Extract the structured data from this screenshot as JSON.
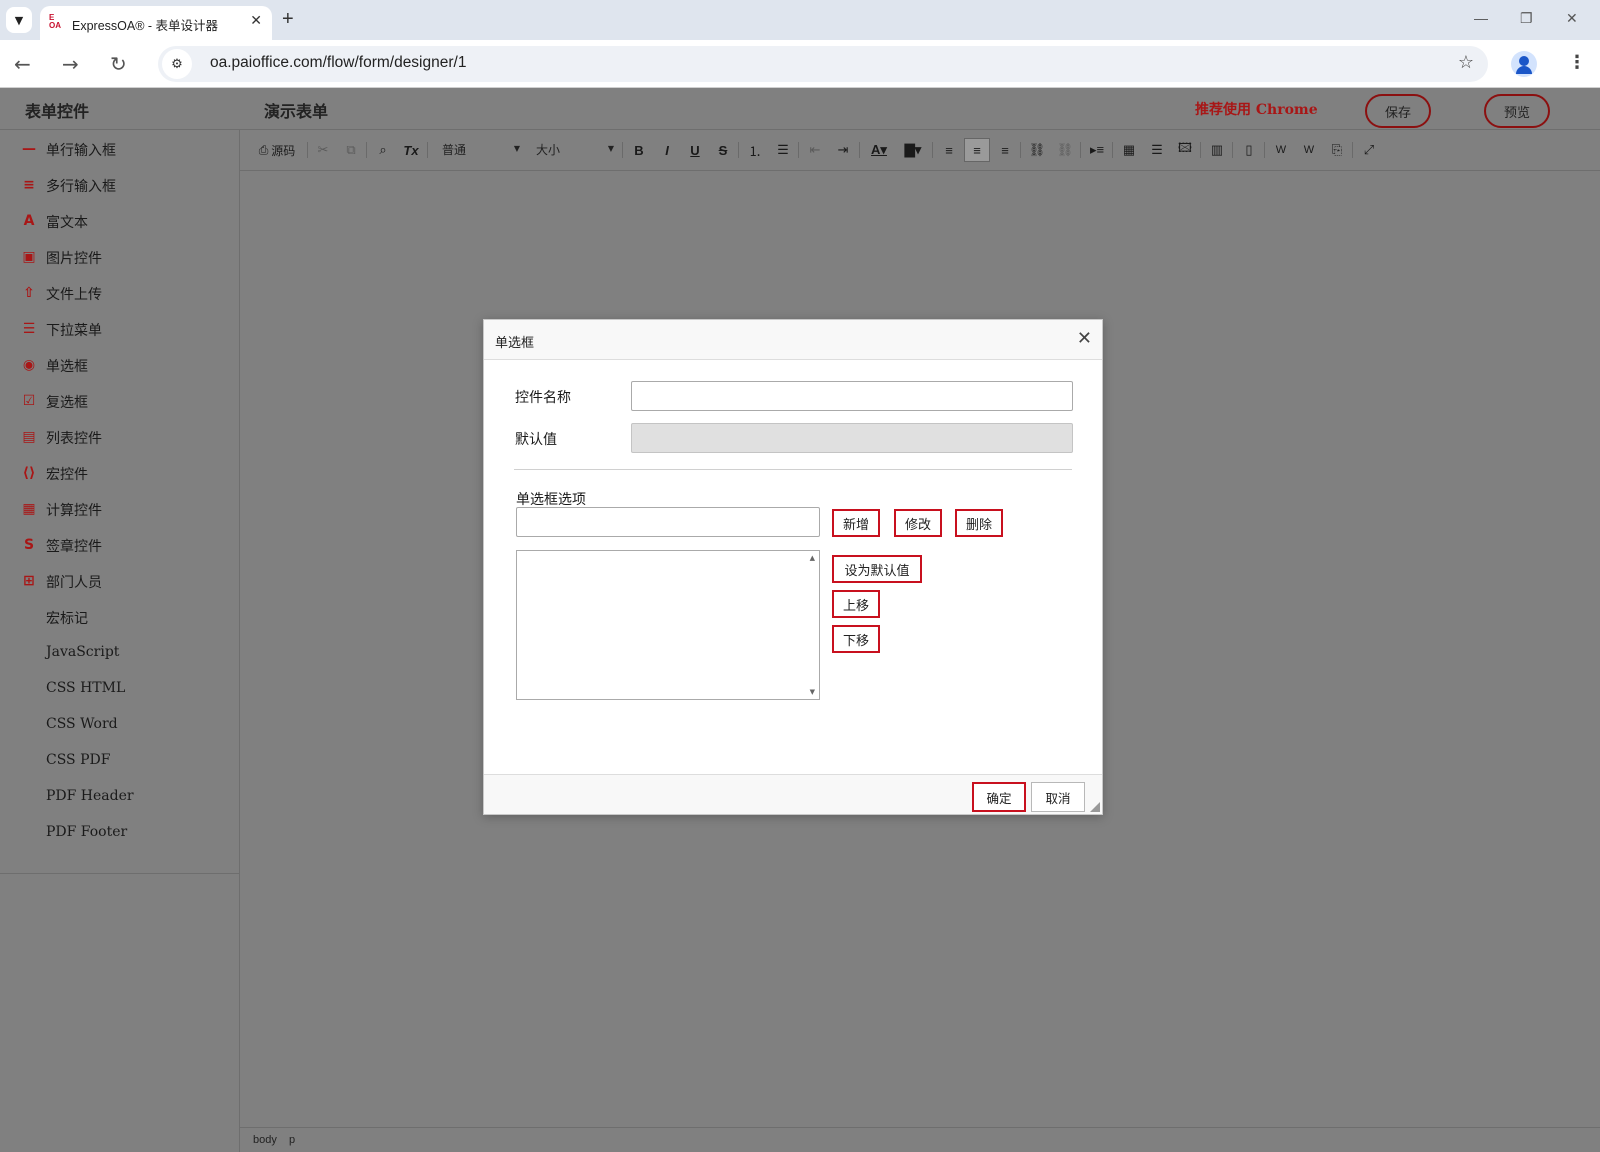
{
  "browser": {
    "tab_title": "ExpressOA® - 表单设计器",
    "favicon_text": "E OA",
    "url": "oa.paioffice.com/flow/form/designer/1"
  },
  "header": {
    "panel_title": "表单控件",
    "form_title": "演示表单",
    "recommend": "推荐使用 Chrome",
    "save_label": "保存",
    "preview_label": "预览"
  },
  "sidebar": {
    "items": [
      {
        "label": "单行输入框",
        "icon": "single-line-icon"
      },
      {
        "label": "多行输入框",
        "icon": "multi-line-icon"
      },
      {
        "label": "富文本",
        "icon": "rich-text-icon"
      },
      {
        "label": "图片控件",
        "icon": "image-icon"
      },
      {
        "label": "文件上传",
        "icon": "file-upload-icon"
      },
      {
        "label": "下拉菜单",
        "icon": "dropdown-icon"
      },
      {
        "label": "单选框",
        "icon": "radio-icon"
      },
      {
        "label": "复选框",
        "icon": "checkbox-icon"
      },
      {
        "label": "列表控件",
        "icon": "list-icon"
      },
      {
        "label": "宏控件",
        "icon": "macro-icon"
      },
      {
        "label": "计算控件",
        "icon": "calculator-icon"
      },
      {
        "label": "签章控件",
        "icon": "signature-icon"
      },
      {
        "label": "部门人员",
        "icon": "department-user-icon"
      },
      {
        "label": "宏标记",
        "icon": ""
      },
      {
        "label": "JavaScript",
        "icon": ""
      },
      {
        "label": "CSS HTML",
        "icon": ""
      },
      {
        "label": "CSS Word",
        "icon": ""
      },
      {
        "label": "CSS PDF",
        "icon": ""
      },
      {
        "label": "PDF Header",
        "icon": ""
      },
      {
        "label": "PDF Footer",
        "icon": ""
      }
    ]
  },
  "toolbar": {
    "source_label": "源码",
    "format_value": "普通",
    "size_value": "大小"
  },
  "statusbar": {
    "path": [
      "body",
      "p"
    ]
  },
  "dialog": {
    "title": "单选框",
    "name_label": "控件名称",
    "name_value": "",
    "default_label": "默认值",
    "default_value": "",
    "options_label": "单选框选项",
    "option_input_value": "",
    "add_label": "新增",
    "modify_label": "修改",
    "delete_label": "删除",
    "set_default_label": "设为默认值",
    "move_up_label": "上移",
    "move_down_label": "下移",
    "ok_label": "确定",
    "cancel_label": "取消"
  },
  "colors": {
    "accent": "#a81616",
    "highlight_border": "#c8101e",
    "overlay": "#808080"
  }
}
